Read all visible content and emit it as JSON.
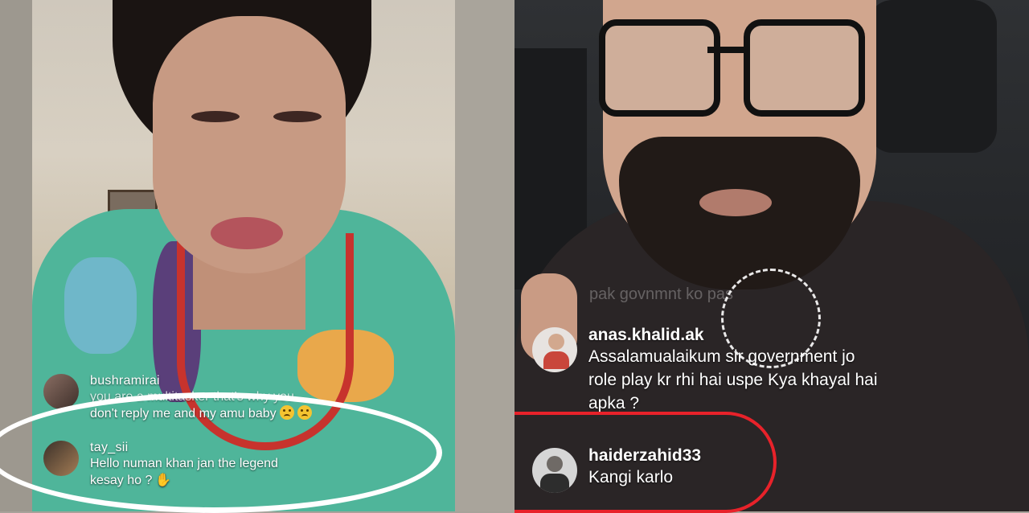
{
  "left_stream": {
    "comments": [
      {
        "username": "bushramirai",
        "text_lines": [
          "you are a multitasker that's why you",
          "don't reply me and my amu baby"
        ],
        "emojis": [
          "frowning-face-icon",
          "frowning-face-icon"
        ]
      },
      {
        "username": "tay_sii",
        "text_lines": [
          "Hello numan khan jan the legend",
          "kesay ho ?"
        ],
        "emojis": [
          "waving-hand-icon"
        ]
      }
    ]
  },
  "right_stream": {
    "faded_comment": "pak govnmnt ko pas",
    "comments": [
      {
        "username": "anas.khalid.ak",
        "text_lines": [
          "Assalamualaikum sir government jo",
          "role play kr rhi hai uspe Kya khayal hai",
          "apka ?"
        ]
      },
      {
        "username": "haiderzahid33",
        "text_lines": [
          "Kangi karlo"
        ]
      }
    ]
  },
  "annotations": {
    "left_highlight_color": "#ffffff",
    "right_highlight_color": "#e8222a"
  }
}
